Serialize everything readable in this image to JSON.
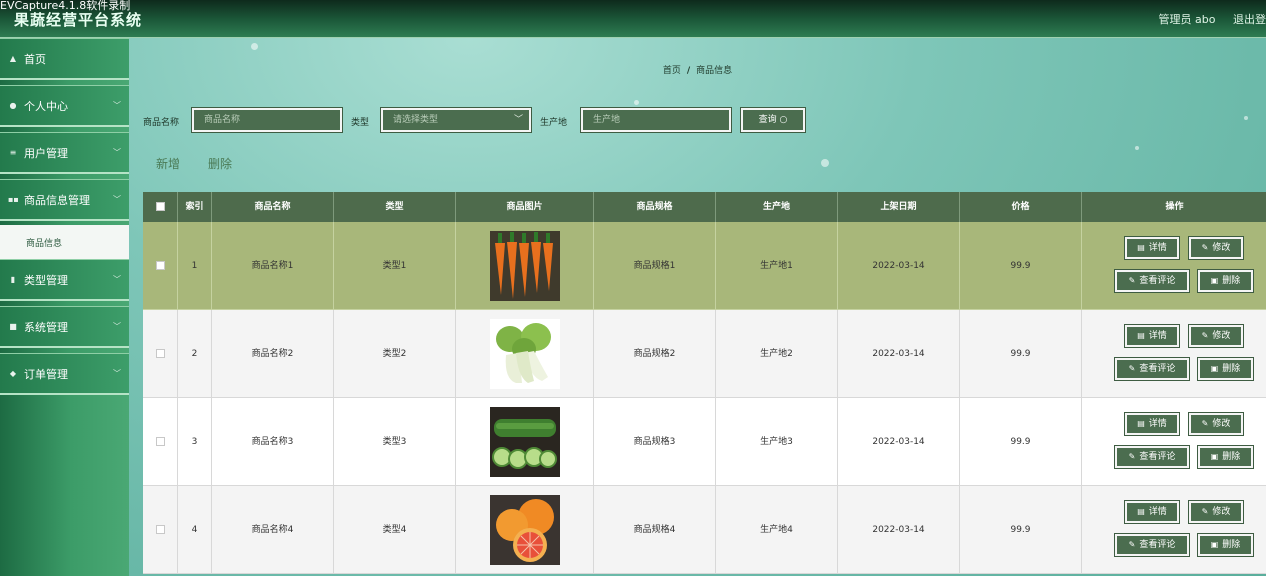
{
  "header": {
    "watermark": "EVCapture4.1.8软件录制",
    "title": "果蔬经营平台系统",
    "user": "管理员 abo",
    "logout": "退出登"
  },
  "sidebar": {
    "items": [
      {
        "label": "首页",
        "icon": "home-icon"
      },
      {
        "label": "个人中心",
        "icon": "user-icon"
      },
      {
        "label": "用户管理",
        "icon": "list-icon"
      },
      {
        "label": "商品信息管理",
        "icon": "grid-icon"
      },
      {
        "label": "类型管理",
        "icon": "bar-chart-icon"
      },
      {
        "label": "系统管理",
        "icon": "monitor-icon"
      },
      {
        "label": "订单管理",
        "icon": "pin-icon"
      }
    ],
    "active_sub": "商品信息"
  },
  "breadcrumb": {
    "home": "首页",
    "sep": "/",
    "current": "商品信息"
  },
  "search": {
    "name_label": "商品名称",
    "name_placeholder": "商品名称",
    "type_label": "类型",
    "type_placeholder": "请选择类型",
    "origin_label": "生产地",
    "origin_placeholder": "生产地",
    "query_label": "查询"
  },
  "actions": {
    "add": "新增",
    "delete": "删除"
  },
  "table": {
    "headers": [
      "索引",
      "商品名称",
      "类型",
      "商品图片",
      "商品规格",
      "生产地",
      "上架日期",
      "价格",
      "操作"
    ],
    "buttons": {
      "detail": "详情",
      "edit": "修改",
      "reviews": "查看评论",
      "delete": "删除"
    },
    "rows": [
      {
        "index": "1",
        "name": "商品名称1",
        "type": "类型1",
        "spec": "商品规格1",
        "origin": "生产地1",
        "date": "2022-03-14",
        "price": "99.9",
        "image": "carrots"
      },
      {
        "index": "2",
        "name": "商品名称2",
        "type": "类型2",
        "spec": "商品规格2",
        "origin": "生产地2",
        "date": "2022-03-14",
        "price": "99.9",
        "image": "bok-choy"
      },
      {
        "index": "3",
        "name": "商品名称3",
        "type": "类型3",
        "spec": "商品规格3",
        "origin": "生产地3",
        "date": "2022-03-14",
        "price": "99.9",
        "image": "cucumber"
      },
      {
        "index": "4",
        "name": "商品名称4",
        "type": "类型4",
        "spec": "商品规格4",
        "origin": "生产地4",
        "date": "2022-03-14",
        "price": "99.9",
        "image": "grapefruit"
      }
    ]
  },
  "colors": {
    "accent": "#4b6d4f",
    "highlight_row": "#a8b77a",
    "sidebar": "#3c9c68"
  }
}
